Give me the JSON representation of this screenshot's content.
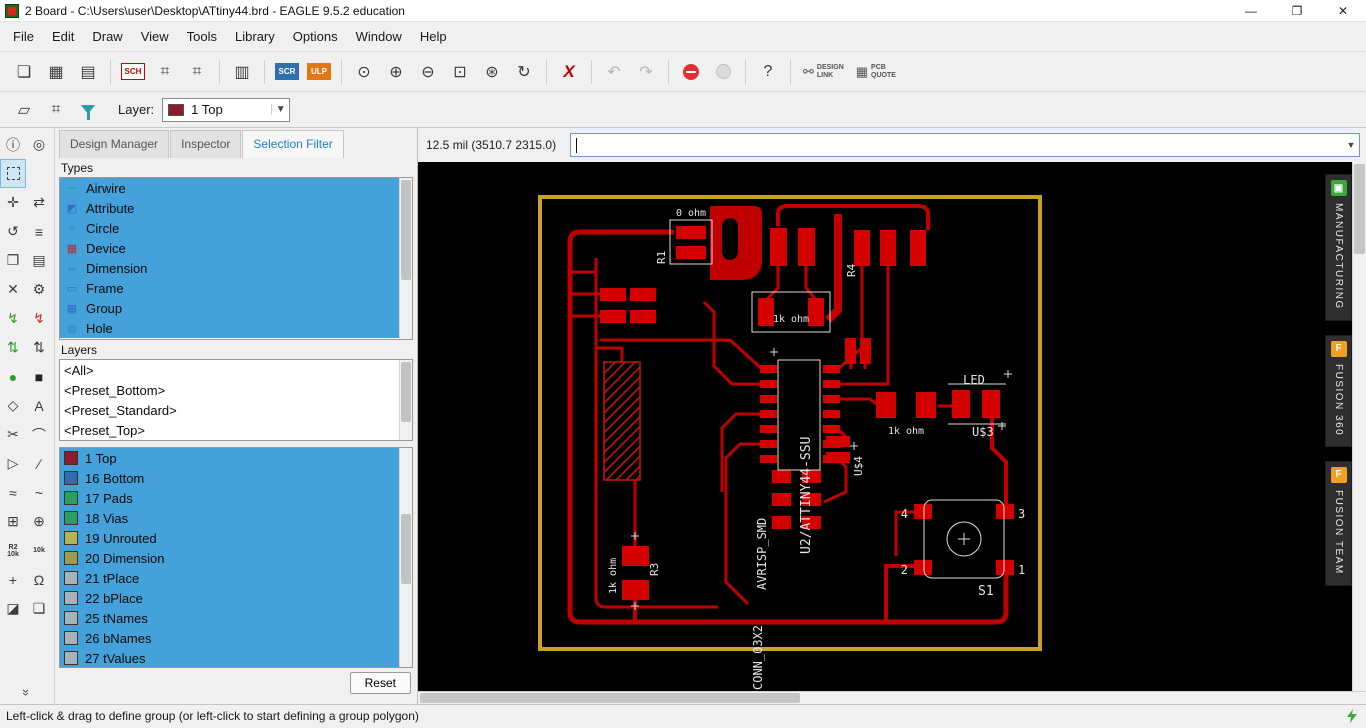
{
  "window": {
    "title": "2 Board - C:\\Users\\user\\Desktop\\ATtiny44.brd - EAGLE 9.5.2 education",
    "controls": {
      "minimize": "—",
      "maximize": "❐",
      "close": "✕"
    }
  },
  "menu": {
    "items": [
      "File",
      "Edit",
      "Draw",
      "View",
      "Tools",
      "Library",
      "Options",
      "Window",
      "Help"
    ]
  },
  "toolbar": {
    "sch_badge": "SCH",
    "scr_badge": "SCR",
    "ulp_badge": "ULP",
    "help_label": "?",
    "design_link": [
      "DESIGN",
      "LINK"
    ],
    "pcb_quote": [
      "PCB",
      "QUOTE"
    ]
  },
  "toolbar2": {
    "layer_label": "Layer:",
    "layer_value": "1 Top",
    "layer_color": "#8e1b2d"
  },
  "panel": {
    "tabs": [
      {
        "label": "Design Manager"
      },
      {
        "label": "Inspector"
      },
      {
        "label": "Selection Filter"
      }
    ],
    "types_header": "Types",
    "types": [
      "Airwire",
      "Attribute",
      "Circle",
      "Device",
      "Dimension",
      "Frame",
      "Group",
      "Hole"
    ],
    "layers_header": "Layers",
    "presets": [
      "<All>",
      "<Preset_Bottom>",
      "<Preset_Standard>",
      "<Preset_Top>"
    ],
    "layer_list": [
      {
        "num": "1",
        "name": "1 Top",
        "color": "#8e1b2d"
      },
      {
        "num": "16",
        "name": "16 Bottom",
        "color": "#2e6db4"
      },
      {
        "num": "17",
        "name": "17 Pads",
        "color": "#2f9e62"
      },
      {
        "num": "18",
        "name": "18 Vias",
        "color": "#2f9e62"
      },
      {
        "num": "19",
        "name": "19 Unrouted",
        "color": "#b4b455"
      },
      {
        "num": "20",
        "name": "20 Dimension",
        "color": "#9c9c4a"
      },
      {
        "num": "21",
        "name": "21 tPlace",
        "color": "#a5b2ba"
      },
      {
        "num": "22",
        "name": "22 bPlace",
        "color": "#a5b2ba"
      },
      {
        "num": "25",
        "name": "25 tNames",
        "color": "#a5b2ba"
      },
      {
        "num": "26",
        "name": "26 bNames",
        "color": "#a5b2ba"
      },
      {
        "num": "27",
        "name": "27 tValues",
        "color": "#a5b2ba"
      }
    ],
    "reset_label": "Reset"
  },
  "canvasbar": {
    "coords": "12.5 mil (3510.7 2315.0)",
    "command_value": "",
    "command_placeholder": ""
  },
  "side_tabs": [
    {
      "label": "MANUFACTURING"
    },
    {
      "label": "FUSION 360"
    },
    {
      "label": "FUSION TEAM"
    }
  ],
  "board": {
    "outline_color": "#c9a227",
    "copper_color": "#c00000",
    "labels": {
      "r1": "R1",
      "r1_value": "0 ohm",
      "r4": "R4",
      "r2_value": "1k ohm",
      "led": "LED",
      "u3": "U$3",
      "rled_value": "1k ohm",
      "u4": "U$4",
      "ic": "U2/ATTINY44-SSU",
      "avrisp": "AVRISP_SMD",
      "conn": "CONN_03X2",
      "r3": "R3",
      "r3_value": "1k ohm",
      "s1": "S1",
      "pin1": "1",
      "pin2": "2",
      "pin3": "3",
      "pin4": "4"
    }
  },
  "statusbar": {
    "hint": "Left-click & drag to define group (or left-click to start defining a group polygon)"
  }
}
